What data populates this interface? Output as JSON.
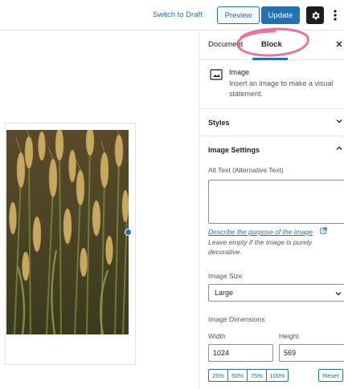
{
  "topbar": {
    "switch_to_draft": "Switch to Draft",
    "preview_label": "Preview",
    "update_label": "Update",
    "settings_icon": "gear-icon",
    "more_icon": "more-vertical-icon"
  },
  "sidebar": {
    "tabs": [
      "Document",
      "Block"
    ],
    "active_tab": "Block",
    "close_icon": "close-icon",
    "block": {
      "title": "Image",
      "description": "Insert an image to make a visual statement.",
      "icon": "image-icon"
    },
    "styles_panel": {
      "title": "Styles",
      "state": "collapsed"
    },
    "image_settings": {
      "title": "Image Settings",
      "state": "expanded",
      "alt_text_label": "Alt Text (Alternative Text)",
      "alt_text_value": "",
      "describe_link": "Describe the purpose of the image",
      "help_text": "Leave empty if the image is purely decorative.",
      "image_size_label": "Image Size",
      "image_size_value": "Large",
      "dimensions_label": "Image Dimensions",
      "width_label": "Width",
      "height_label": "Height",
      "width_value": "1024",
      "height_value": "569",
      "percent_buttons": [
        "25%",
        "50%",
        "75%",
        "100%"
      ],
      "reset_label": "Reset"
    }
  },
  "colors": {
    "accent": "#2271b1",
    "annotation": "#e8437a"
  }
}
